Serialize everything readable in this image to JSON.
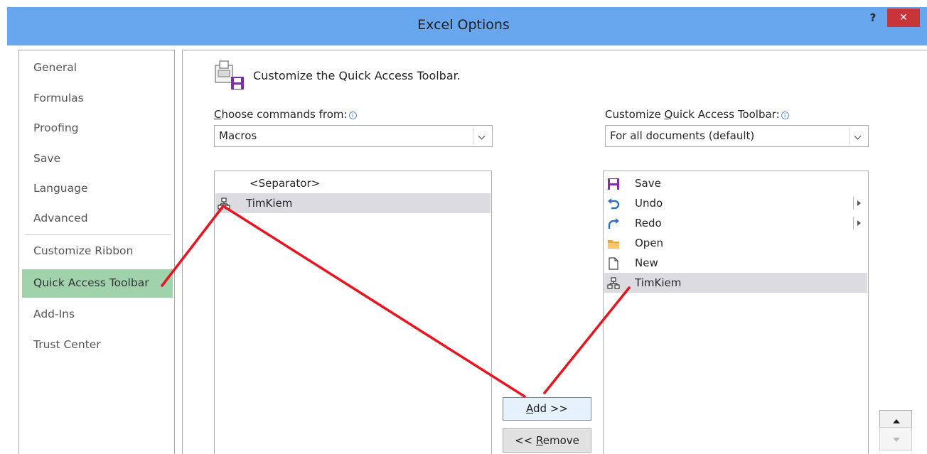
{
  "dialog": {
    "title": "Excel Options",
    "help_label": "?",
    "close_label": "✕"
  },
  "nav": {
    "items": [
      {
        "label": "General"
      },
      {
        "label": "Formulas"
      },
      {
        "label": "Proofing"
      },
      {
        "label": "Save"
      },
      {
        "label": "Language"
      },
      {
        "label": "Advanced"
      },
      {
        "label": "Customize Ribbon"
      },
      {
        "label": "Quick Access Toolbar",
        "selected": true
      },
      {
        "label": "Add-Ins"
      },
      {
        "label": "Trust Center"
      }
    ]
  },
  "main": {
    "heading": "Customize the Quick Access Toolbar.",
    "choose_label_first": "C",
    "choose_label_rest": "hoose commands from:",
    "choose_value": "Macros",
    "customize_label_pre": "Customize ",
    "customize_label_key": "Q",
    "customize_label_post": "uick Access Toolbar:",
    "customize_value": "For all documents (default)",
    "info_glyph": "i"
  },
  "commands_list": [
    {
      "label": "<Separator>",
      "icon": "none"
    },
    {
      "label": "TimKiem",
      "icon": "macro-icon",
      "selected": true
    }
  ],
  "toolbar_list": [
    {
      "label": "Save",
      "icon": "save-icon"
    },
    {
      "label": "Undo",
      "icon": "undo-icon",
      "submenu": true
    },
    {
      "label": "Redo",
      "icon": "redo-icon",
      "submenu": true
    },
    {
      "label": "Open",
      "icon": "folder-icon"
    },
    {
      "label": "New",
      "icon": "new-document-icon"
    },
    {
      "label": "TimKiem",
      "icon": "macro-icon",
      "selected": true
    }
  ],
  "buttons": {
    "add_key": "A",
    "add_rest": "dd >>",
    "remove_pre": "<< ",
    "remove_key": "R",
    "remove_rest": "emove"
  },
  "colors": {
    "title_bar": "#68a6ee",
    "nav_selected": "#a0d2ab",
    "close_button": "#c7353a",
    "annotation_line": "#e8141f"
  }
}
